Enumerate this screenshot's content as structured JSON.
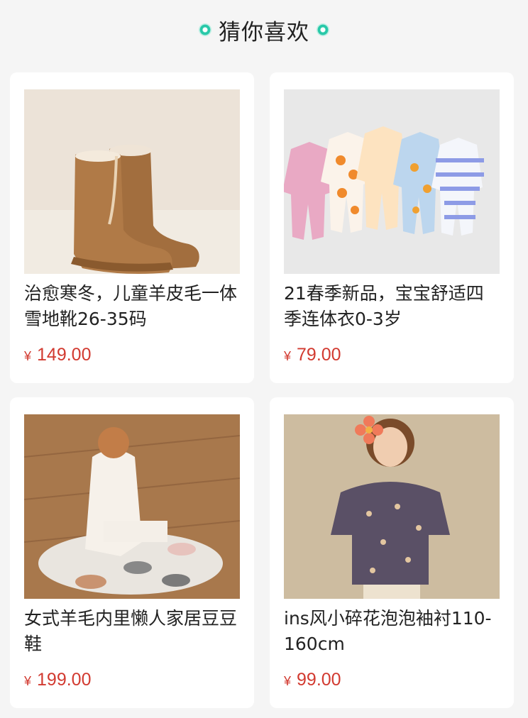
{
  "section": {
    "title": "猜你喜欢",
    "accent_color": "#28c8a8"
  },
  "products": [
    {
      "name": "治愈寒冬，儿童羊皮毛一体雪地靴26-35码",
      "currency": "¥",
      "price": "149.00",
      "image": "kids-sheepskin-snow-boots"
    },
    {
      "name": "21春季新品，宝宝舒适四季连体衣0-3岁",
      "currency": "¥",
      "price": "79.00",
      "image": "baby-onesies-row"
    },
    {
      "name": "女式羊毛内里懒人家居豆豆鞋",
      "currency": "¥",
      "price": "199.00",
      "image": "woman-with-loafers"
    },
    {
      "name": "ins风小碎花泡泡袖衬110-160cm",
      "currency": "¥",
      "price": "99.00",
      "image": "girl-floral-blouse"
    }
  ],
  "colors": {
    "price": "#d23a30",
    "card_bg": "#ffffff",
    "page_bg": "#f5f5f5"
  }
}
